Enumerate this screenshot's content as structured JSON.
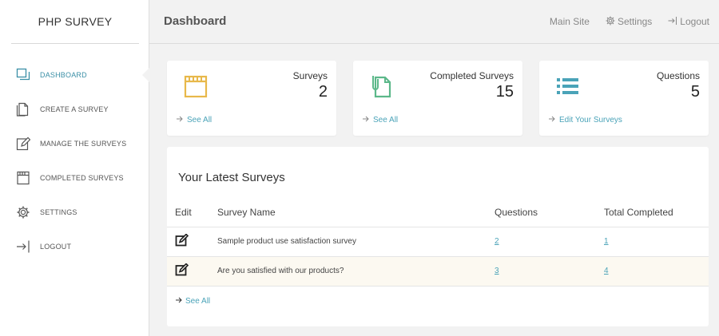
{
  "brand": "PHP SURVEY",
  "header": {
    "title": "Dashboard",
    "links": {
      "main_site": "Main Site",
      "settings": "Settings",
      "logout": "Logout"
    }
  },
  "sidebar": {
    "items": [
      {
        "label": "DASHBOARD",
        "icon": "dashboard-icon",
        "active": true
      },
      {
        "label": "CREATE A SURVEY",
        "icon": "create-survey-icon"
      },
      {
        "label": "MANAGE THE SURVEYS",
        "icon": "manage-surveys-icon"
      },
      {
        "label": "COMPLETED SURVEYS",
        "icon": "completed-surveys-icon"
      },
      {
        "label": "SETTINGS",
        "icon": "gear-icon"
      },
      {
        "label": "LOGOUT",
        "icon": "logout-icon"
      }
    ]
  },
  "cards": [
    {
      "title": "Surveys",
      "value": "2",
      "link": "See All",
      "icon": "survey-window-icon"
    },
    {
      "title": "Completed Surveys",
      "value": "15",
      "link": "See All",
      "icon": "document-clip-icon"
    },
    {
      "title": "Questions",
      "value": "5",
      "link": "Edit Your Surveys",
      "icon": "list-icon"
    }
  ],
  "latest": {
    "title": "Your Latest Surveys",
    "columns": {
      "edit": "Edit",
      "name": "Survey Name",
      "questions": "Questions",
      "completed": "Total Completed"
    },
    "rows": [
      {
        "name": "Sample product use satisfaction survey",
        "questions": "2",
        "completed": "1"
      },
      {
        "name": "Are you satisfied with our products?",
        "questions": "3",
        "completed": "4"
      }
    ],
    "see_all": "See All"
  },
  "colors": {
    "accent": "#4aa3b8",
    "card_icon_survey": "#e8b84a",
    "card_icon_doc": "#5cb88a",
    "card_icon_list": "#4aa3b8"
  }
}
